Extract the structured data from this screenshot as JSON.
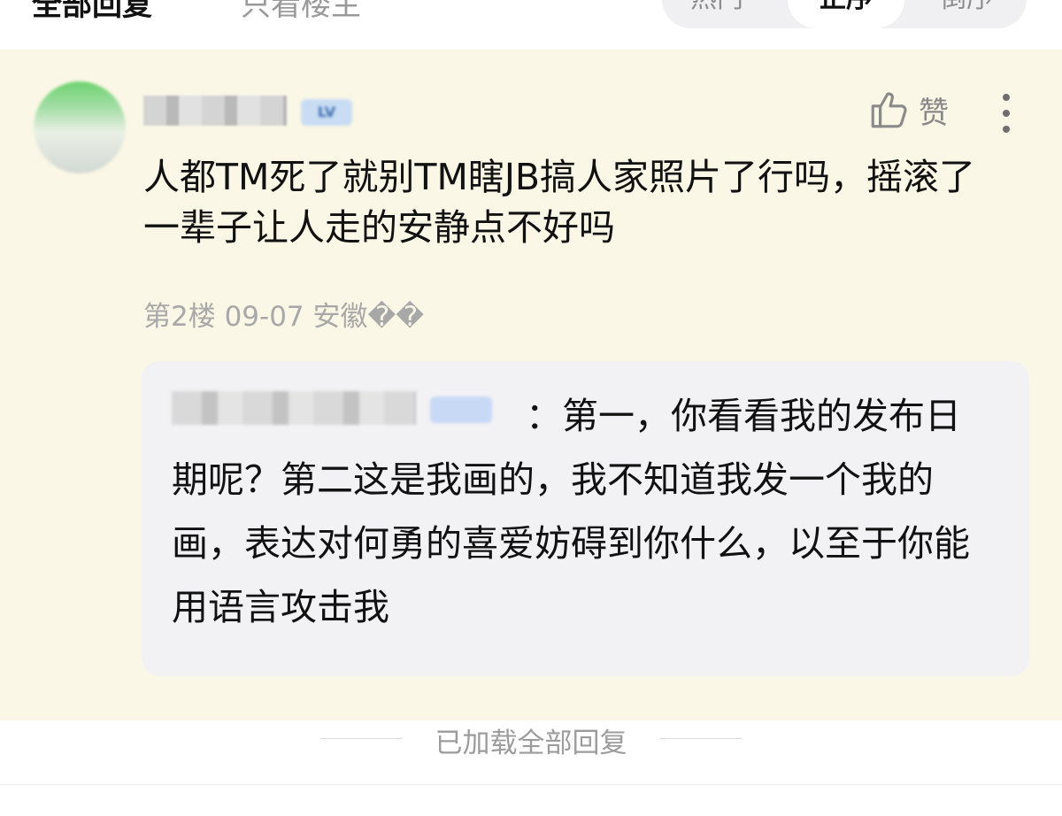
{
  "header": {
    "tab_all": "全部回复",
    "tab_owner_only": "只看楼主",
    "sort_options": [
      "热门",
      "正序",
      "倒序"
    ]
  },
  "post": {
    "like_label": "赞",
    "content": "人都TM死了就别TM瞎JB搞人家照片了行吗，摇滚了一辈子让人走的安静点不好吗",
    "meta": "第2楼 09-07 安徽��",
    "colors": {
      "floor_highlight": "#fbf7e6",
      "reply_card": "#f2f2f5"
    }
  },
  "reply": {
    "text": "：第一，你看看我的发布日期呢？第二这是我画的，我不知道我发一个我的画，表达对何勇的喜爱妨碍到你什么，以至于你能用语言攻击我"
  },
  "footer": {
    "loaded_all": "已加载全部回复"
  },
  "icons": [
    "thumbs-up-icon",
    "more-vertical-icon"
  ]
}
